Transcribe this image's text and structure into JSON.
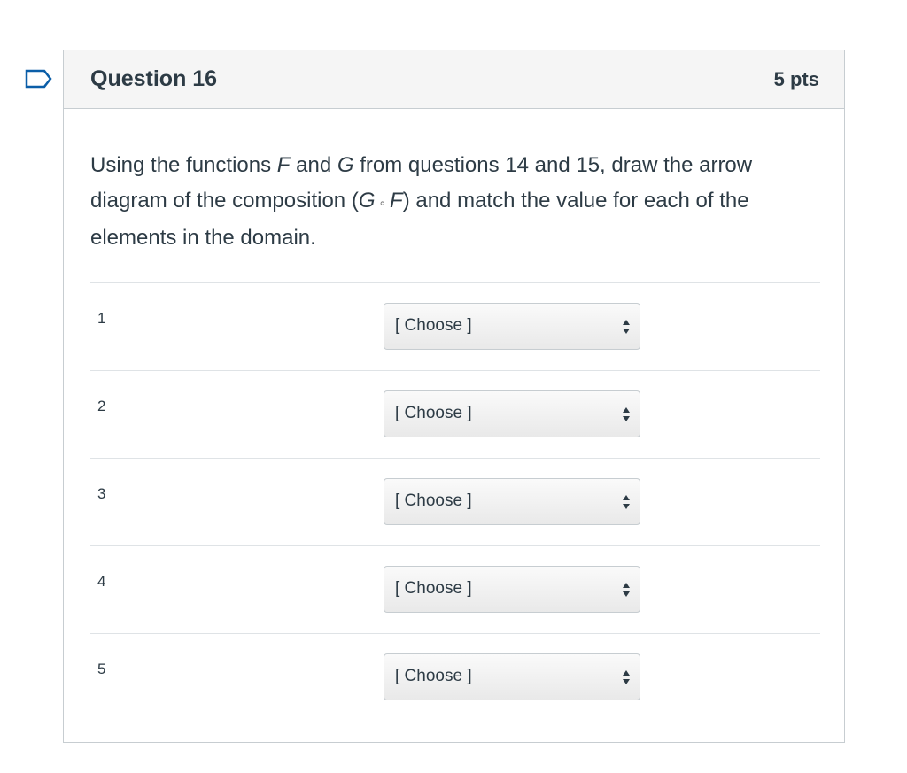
{
  "question": {
    "title": "Question 16",
    "points": "5 pts",
    "text_parts": {
      "p1": "Using the functions ",
      "f1": "F",
      "p2": " and ",
      "g1": "G",
      "p3": " from questions 14 and 15, draw the arrow diagram of the composition (",
      "g2": "G",
      "op": " ∘ ",
      "f2": "F",
      "p4": ")  and match the value for each of the elements in the domain."
    }
  },
  "answers": [
    {
      "label": "1",
      "selected": "[ Choose ]"
    },
    {
      "label": "2",
      "selected": "[ Choose ]"
    },
    {
      "label": "3",
      "selected": "[ Choose ]"
    },
    {
      "label": "4",
      "selected": "[ Choose ]"
    },
    {
      "label": "5",
      "selected": "[ Choose ]"
    }
  ],
  "icons": {
    "flag": "flag-bookmark-icon",
    "select_arrows": "updown-arrows-icon"
  },
  "colors": {
    "flag_blue": "#0b5ea8",
    "header_bg": "#f5f5f5",
    "border": "#c7cdd1",
    "text": "#2d3b45"
  }
}
